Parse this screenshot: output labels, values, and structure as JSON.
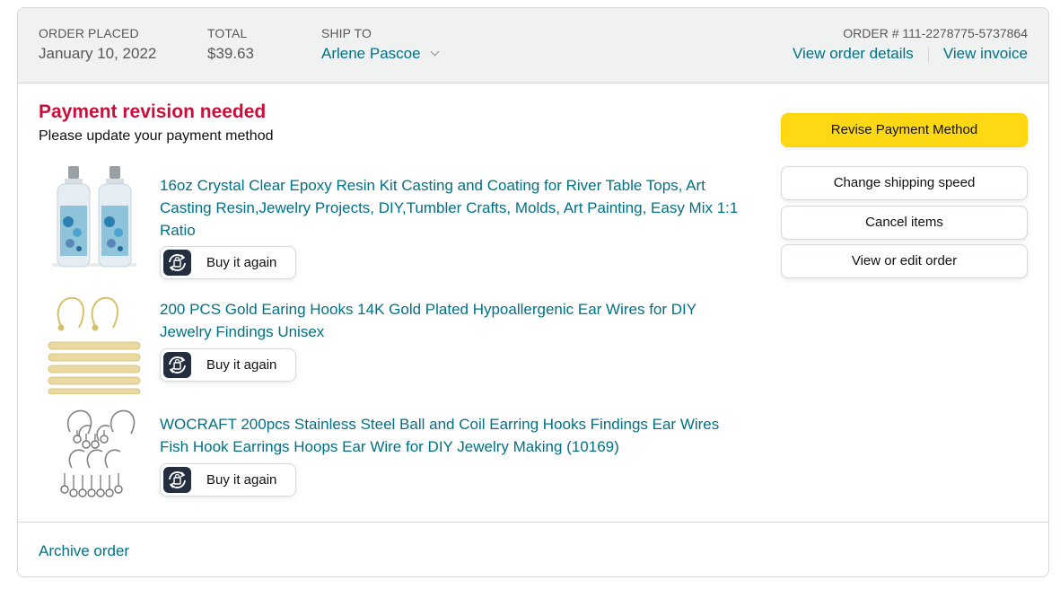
{
  "header": {
    "order_placed_label": "ORDER PLACED",
    "order_placed_value": "January 10, 2022",
    "total_label": "TOTAL",
    "total_value": "$39.63",
    "ship_to_label": "SHIP TO",
    "ship_to_value": "Arlene Pascoe",
    "order_number": "ORDER # 111-2278775-5737864",
    "view_order_details": "View order details",
    "view_invoice": "View invoice"
  },
  "status": {
    "title": "Payment revision needed",
    "subtitle": "Please update your payment method"
  },
  "items": [
    {
      "title": "16oz Crystal Clear Epoxy Resin Kit Casting and Coating for River Table Tops, Art Casting Resin,Jewelry Projects, DIY,Tumbler Crafts, Molds, Art Painting, Easy Mix 1:1 Ratio",
      "buy_again": "Buy it again",
      "image": "epoxy-resin-bottles"
    },
    {
      "title": "200 PCS Gold Earing Hooks 14K Gold Plated Hypoallergenic Ear Wires for DIY Jewelry Findings Unisex",
      "buy_again": "Buy it again",
      "image": "gold-ear-hooks"
    },
    {
      "title": "WOCRAFT 200pcs Stainless Steel Ball and Coil Earring Hooks Findings Ear Wires Fish Hook Earrings Hoops Ear Wire for DIY Jewelry Making (10169)",
      "buy_again": "Buy it again",
      "image": "steel-ear-hooks"
    }
  ],
  "actions": {
    "revise_payment": "Revise Payment Method",
    "change_shipping": "Change shipping speed",
    "cancel_items": "Cancel items",
    "view_edit_order": "View or edit order"
  },
  "footer": {
    "archive": "Archive order"
  },
  "colors": {
    "link": "#007185",
    "alert": "#cc0c39",
    "primary_button": "#ffd814",
    "header_bg": "#f0f2f2"
  },
  "icons": {
    "buy_again": "buy-again-icon",
    "ship_to_dropdown": "chevron-down-icon"
  }
}
